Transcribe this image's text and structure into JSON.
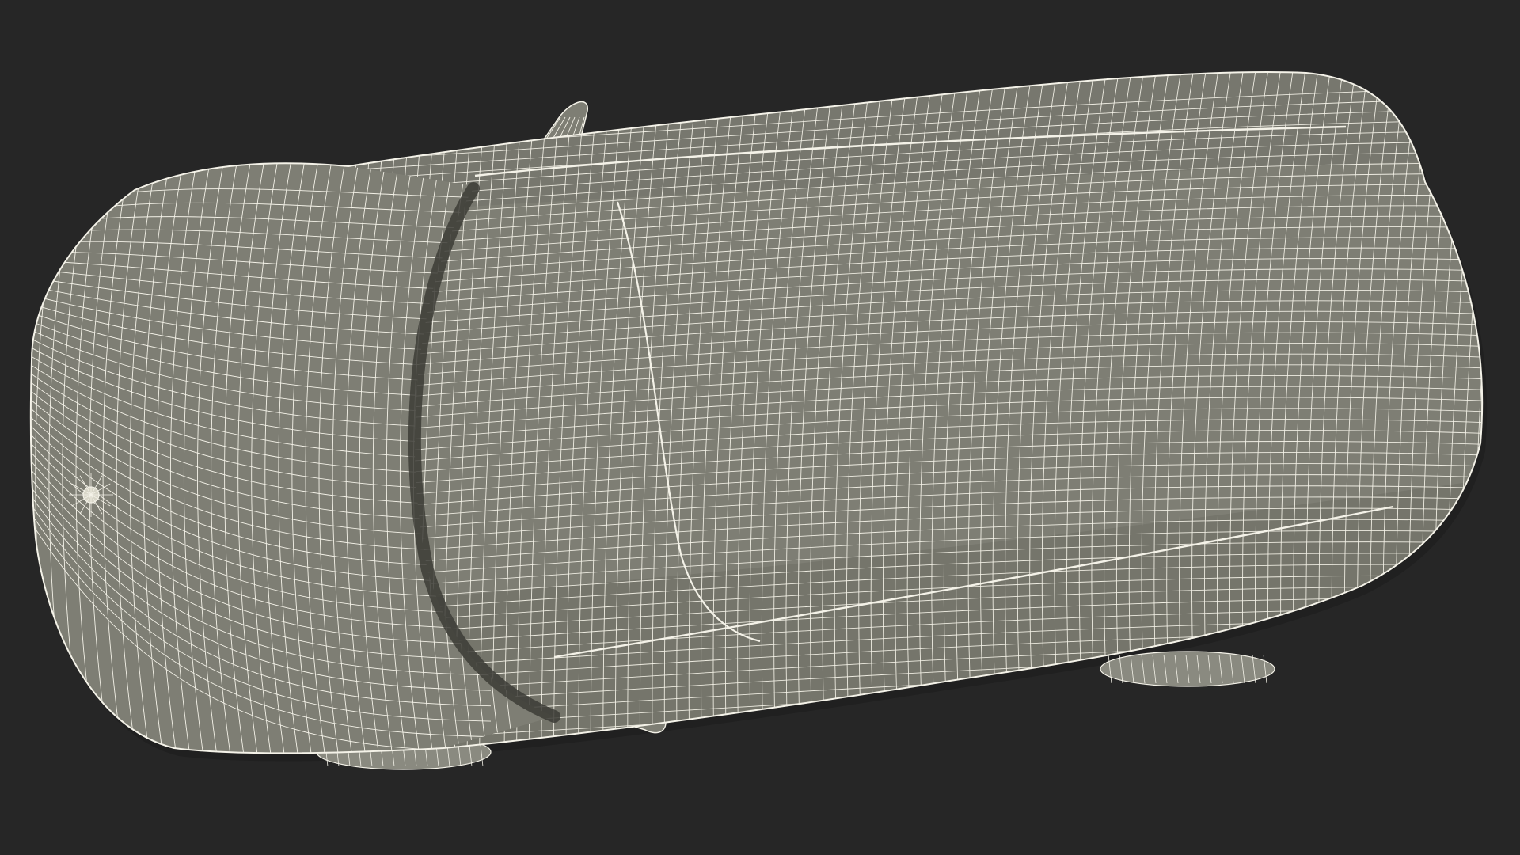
{
  "scene": {
    "subject": "car-wireframe-top-view",
    "background_color": "#262626",
    "body_fill_color": "#7e7e74",
    "body_shadow_color": "#65655c",
    "wire_color": "#f4f2e8",
    "seam_color": "#3c3c36",
    "wireframe_density": {
      "length_lines": 120,
      "width_lines": 56
    }
  }
}
